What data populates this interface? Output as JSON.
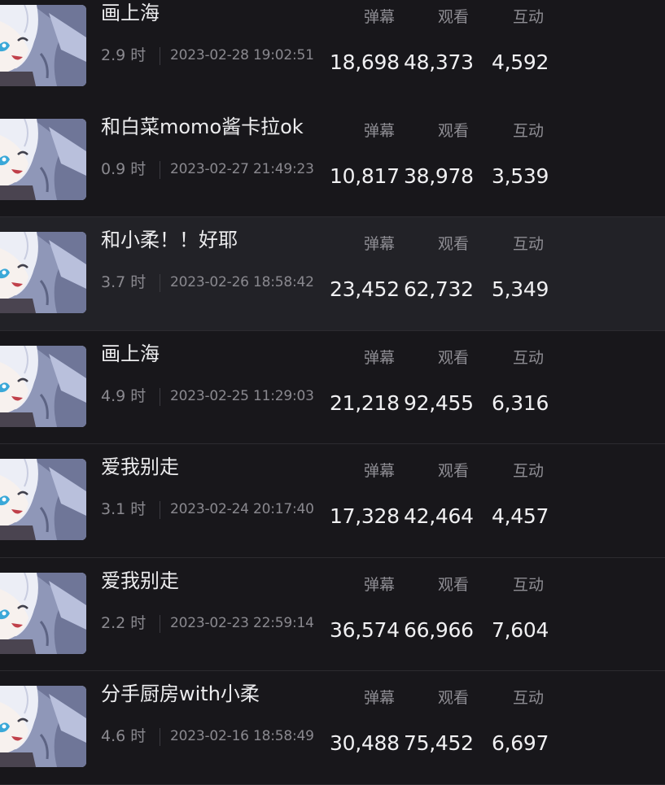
{
  "columns": {
    "danmaku_label": "弹幕",
    "views_label": "观看",
    "interaction_label": "互动"
  },
  "colors": {
    "background": "#18171b",
    "highlight_row": "#222227",
    "divider": "#2c2b30",
    "text_primary": "#ececee",
    "text_secondary": "#8a898f"
  },
  "thumbnail_icon": "anime-avatar-thumbnail",
  "items": [
    {
      "title": "画上海",
      "duration": "2.9 时",
      "datetime": "2023-02-28 19:02:51",
      "danmaku": "18,698",
      "views": "48,373",
      "interaction": "4,592",
      "highlighted": false
    },
    {
      "title": "和白菜momo酱卡拉ok",
      "duration": "0.9 时",
      "datetime": "2023-02-27 21:49:23",
      "danmaku": "10,817",
      "views": "38,978",
      "interaction": "3,539",
      "highlighted": false
    },
    {
      "title": "和小柔！！好耶",
      "duration": "3.7 时",
      "datetime": "2023-02-26 18:58:42",
      "danmaku": "23,452",
      "views": "62,732",
      "interaction": "5,349",
      "highlighted": true
    },
    {
      "title": "画上海",
      "duration": "4.9 时",
      "datetime": "2023-02-25 11:29:03",
      "danmaku": "21,218",
      "views": "92,455",
      "interaction": "6,316",
      "highlighted": false
    },
    {
      "title": "爱我别走",
      "duration": "3.1 时",
      "datetime": "2023-02-24 20:17:40",
      "danmaku": "17,328",
      "views": "42,464",
      "interaction": "4,457",
      "highlighted": false
    },
    {
      "title": "爱我别走",
      "duration": "2.2 时",
      "datetime": "2023-02-23 22:59:14",
      "danmaku": "36,574",
      "views": "66,966",
      "interaction": "7,604",
      "highlighted": false
    },
    {
      "title": "分手厨房with小柔",
      "duration": "4.6 时",
      "datetime": "2023-02-16 18:58:49",
      "danmaku": "30,488",
      "views": "75,452",
      "interaction": "6,697",
      "highlighted": false
    }
  ]
}
